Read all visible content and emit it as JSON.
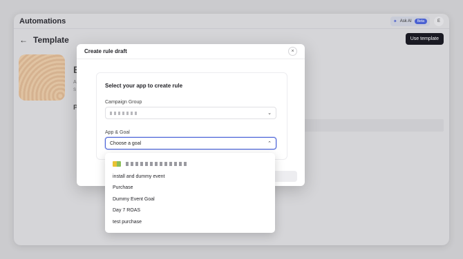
{
  "app": {
    "title": "Automations",
    "ask_ai_label": "Ask AI",
    "beta_badge": "Beta",
    "avatar_initial": "E"
  },
  "page": {
    "title": "Template",
    "use_template_label": "Use template",
    "bg_heading_initial": "E",
    "bg_text_a": "A",
    "bg_text_s": "S",
    "bg_section_initial": "P"
  },
  "modal": {
    "title": "Create rule draft",
    "close_icon": "×",
    "heading": "Select your app to create rule",
    "campaign_group": {
      "label": "Campaign Group",
      "value": "(redacted)"
    },
    "app_goal": {
      "label": "App & Goal",
      "placeholder": "Choose a goal"
    }
  },
  "dropdown": {
    "app_name": "(redacted)",
    "options": [
      "install and dummy event",
      "Purchase",
      "Dummy Event Goal",
      "Day 7 ROAS",
      "test purchase"
    ]
  },
  "icons": {
    "back": "arrow-left-icon",
    "sparkle": "sparkle-icon",
    "close": "close-icon",
    "chevron_down": "chevron-down-icon",
    "chevron_up": "chevron-up-icon"
  },
  "colors": {
    "accent": "#4b63d8",
    "primary_button": "#1a1a22"
  }
}
